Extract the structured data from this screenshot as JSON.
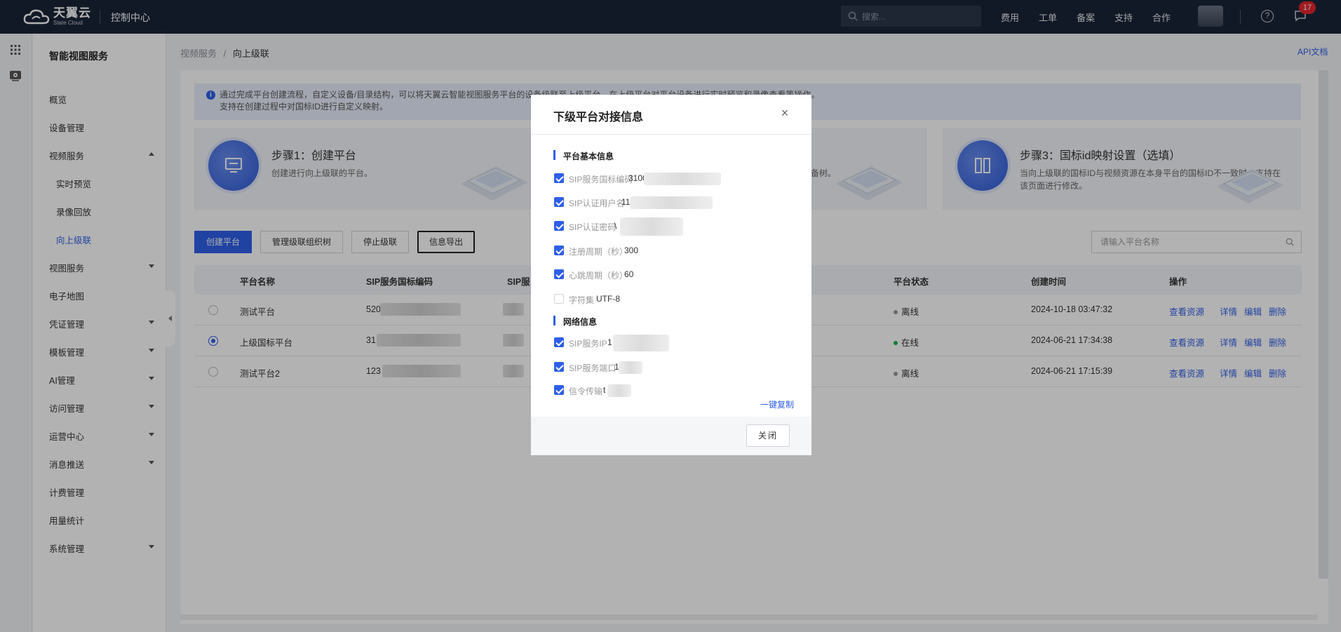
{
  "topbar": {
    "logo_cn": "天翼云",
    "logo_en": "State Cloud",
    "console": "控制中心",
    "search_placeholder": "搜索...",
    "nav": [
      "费用",
      "工单",
      "备案",
      "支持",
      "合作"
    ],
    "message_count": "17",
    "help": "?"
  },
  "sidebar": {
    "title": "智能视图服务",
    "items": [
      {
        "label": "概览"
      },
      {
        "label": "设备管理"
      },
      {
        "label": "视频服务"
      },
      {
        "label": "实时预览"
      },
      {
        "label": "录像回放"
      },
      {
        "label": "向上级联"
      },
      {
        "label": "视图服务"
      },
      {
        "label": "电子地图"
      },
      {
        "label": "凭证管理"
      },
      {
        "label": "模板管理"
      },
      {
        "label": "AI管理"
      },
      {
        "label": "访问管理"
      },
      {
        "label": "运营中心"
      },
      {
        "label": "消息推送"
      },
      {
        "label": "计费管理"
      },
      {
        "label": "用量统计"
      },
      {
        "label": "系统管理"
      }
    ]
  },
  "breadcrumb": {
    "parent": "视频服务",
    "sep": "/",
    "current": "向上级联"
  },
  "api_doc": "API文档",
  "notice": {
    "icon": "i",
    "line1": "通过完成平台创建流程，自定义设备/目录结构，可以将天翼云智能视图服务平台的设备级联至上级平台，在上级平台对平台设备进行实时预览和录像查看等操作。",
    "line2": "支持在创建过程中对国标ID进行自定义映射。"
  },
  "steps": [
    {
      "title": "步骤1：创建平台",
      "desc": "创建进行向上级联的平台。"
    },
    {
      "desc": "及设备树。"
    },
    {
      "title": "步骤3：国标id映射设置（选填）",
      "desc": "当向上级联的国标ID与视频资源在本身平台的国标ID不一致时，支持在该页面进行修改。"
    }
  ],
  "toolbar": {
    "create": "创建平台",
    "manage_org": "管理级联组织树",
    "stop": "停止级联",
    "export": "信息导出",
    "search_placeholder": "请输入平台名称"
  },
  "table": {
    "headers": {
      "name": "平台名称",
      "sip_code": "SIP服务国标编码",
      "sip_other": "SIP服",
      "status": "平台状态",
      "created": "创建时间",
      "ops": "操作"
    },
    "rows": [
      {
        "name": "测试平台",
        "code_prefix": "520",
        "status": "离线",
        "created": "2024-10-18 03:47:32"
      },
      {
        "name": "上级国标平台",
        "code_prefix": "31",
        "status": "在线",
        "created": "2024-06-21 17:34:38"
      },
      {
        "name": "测试平台2",
        "code_prefix": "123",
        "status": "离线",
        "created": "2024-06-21 17:15:39"
      }
    ],
    "ops": [
      "查看资源",
      "详情",
      "编辑",
      "删除"
    ]
  },
  "modal": {
    "title": "下级平台对接信息",
    "close_glyph": "×",
    "section_basic": "平台基本信息",
    "section_network": "网络信息",
    "fields": [
      {
        "label": "SIP服务国标编码",
        "value": "3100"
      },
      {
        "label": "SIP认证用户名",
        "value": "11"
      },
      {
        "label": "SIP认证密码",
        "value": "\\"
      },
      {
        "label": "注册周期（秒）",
        "value": "300"
      },
      {
        "label": "心跳周期（秒）",
        "value": "60"
      },
      {
        "label": "字符集",
        "value": "UTF-8"
      },
      {
        "label": "SIP服务IP",
        "value": "1"
      },
      {
        "label": "SIP服务端口",
        "value": "1"
      },
      {
        "label": "信令传输",
        "value": "t"
      }
    ],
    "copy_all": "一键复制",
    "close_button": "关闭"
  },
  "colors": {
    "accent": "#2e5fe8",
    "topbar": "#1b2437",
    "online": "#1fb14f",
    "badge": "#e5242b"
  }
}
